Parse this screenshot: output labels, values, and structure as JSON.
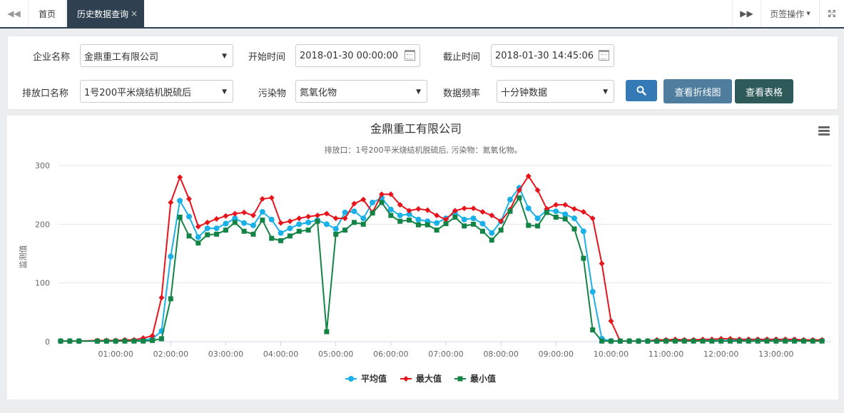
{
  "tabbar": {
    "prev_icon": "double-left-icon",
    "home_label": "首页",
    "active_label": "历史数据查询",
    "close_icon": "×",
    "next_icon": "double-right-icon",
    "tab_ops_label": "页签操作",
    "fullscreen_icon": "expand-icon"
  },
  "filter": {
    "company_label": "企业名称",
    "company_value": "金鼎重工有限公司",
    "start_label": "开始时间",
    "start_value": "2018-01-30 00:00:00",
    "end_label": "截止时间",
    "end_value": "2018-01-30 14:45:06",
    "outlet_label": "排放口名称",
    "outlet_value": "1号200平米烧结机脱硫后",
    "pollutant_label": "污染物",
    "pollutant_value": "氮氧化物",
    "freq_label": "数据频率",
    "freq_value": "十分钟数据",
    "search_icon": "search-icon",
    "line_button": "查看折线图",
    "table_button": "查看表格",
    "colors": {
      "search": "#337ab7",
      "line": "#4f7d9d",
      "table": "#2f5a5a"
    }
  },
  "chart_data": {
    "type": "line",
    "title": "金鼎重工有限公司",
    "subtitle": "排放口：1号200平米烧结机脱硫后, 污染物：氮氧化物。",
    "ylabel": "监测值",
    "ylim": [
      0,
      300
    ],
    "yticks": [
      0,
      100,
      200,
      300
    ],
    "xrange": [
      0,
      840
    ],
    "xticks": [
      {
        "v": 60,
        "label": "01:00:00"
      },
      {
        "v": 120,
        "label": "02:00:00"
      },
      {
        "v": 180,
        "label": "03:00:00"
      },
      {
        "v": 240,
        "label": "04:00:00"
      },
      {
        "v": 300,
        "label": "05:00:00"
      },
      {
        "v": 360,
        "label": "06:00:00"
      },
      {
        "v": 420,
        "label": "07:00:00"
      },
      {
        "v": 480,
        "label": "08:00:00"
      },
      {
        "v": 540,
        "label": "09:00:00"
      },
      {
        "v": 600,
        "label": "10:00:00"
      },
      {
        "v": 660,
        "label": "11:00:00"
      },
      {
        "v": 720,
        "label": "12:00:00"
      },
      {
        "v": 780,
        "label": "13:00:00"
      }
    ],
    "x_minutes": [
      0,
      10,
      20,
      40,
      50,
      60,
      70,
      80,
      90,
      100,
      110,
      120,
      130,
      140,
      150,
      160,
      170,
      180,
      190,
      200,
      210,
      220,
      230,
      240,
      250,
      260,
      270,
      280,
      290,
      300,
      310,
      320,
      330,
      340,
      350,
      360,
      370,
      380,
      390,
      400,
      410,
      420,
      430,
      440,
      450,
      460,
      470,
      480,
      490,
      500,
      510,
      520,
      530,
      540,
      550,
      560,
      570,
      580,
      590,
      600,
      610,
      620,
      630,
      640,
      650,
      660,
      670,
      680,
      690,
      700,
      710,
      720,
      730,
      740,
      750,
      760,
      770,
      780,
      790,
      800,
      810,
      820,
      830
    ],
    "series": [
      {
        "name": "平均值",
        "color": "#1ab0e8",
        "marker": "circle",
        "values": [
          1,
          1,
          1,
          1,
          1,
          1,
          2,
          2,
          3,
          5,
          18,
          145,
          240,
          213,
          178,
          193,
          193,
          201,
          210,
          202,
          198,
          221,
          208,
          185,
          193,
          200,
          203,
          207,
          200,
          192,
          220,
          222,
          210,
          237,
          245,
          225,
          215,
          217,
          208,
          205,
          202,
          210,
          220,
          208,
          210,
          201,
          185,
          205,
          242,
          262,
          227,
          210,
          224,
          222,
          217,
          210,
          188,
          85,
          5,
          1,
          1,
          1,
          1,
          1,
          1,
          2,
          2,
          2,
          2,
          2,
          2,
          2,
          2,
          3,
          3,
          3,
          3,
          3,
          3,
          3,
          2,
          2,
          2
        ]
      },
      {
        "name": "最大值",
        "color": "#e8141c",
        "marker": "diamond",
        "values": [
          1,
          1,
          1,
          2,
          2,
          2,
          3,
          3,
          6,
          10,
          75,
          237,
          280,
          243,
          196,
          203,
          209,
          214,
          218,
          220,
          215,
          243,
          245,
          202,
          205,
          210,
          213,
          215,
          218,
          210,
          210,
          235,
          242,
          220,
          251,
          251,
          233,
          223,
          226,
          224,
          215,
          208,
          223,
          227,
          227,
          221,
          215,
          205,
          225,
          258,
          282,
          258,
          226,
          233,
          233,
          226,
          221,
          210,
          133,
          35,
          1,
          1,
          1,
          1,
          3,
          3,
          4,
          3,
          3,
          4,
          4,
          5,
          5,
          4,
          4,
          4,
          4,
          4,
          4,
          4,
          3,
          3,
          3
        ]
      },
      {
        "name": "最小值",
        "color": "#148446",
        "marker": "square",
        "values": [
          1,
          1,
          1,
          1,
          1,
          1,
          1,
          1,
          1,
          2,
          5,
          73,
          212,
          180,
          168,
          182,
          183,
          190,
          203,
          188,
          183,
          207,
          176,
          172,
          180,
          188,
          190,
          205,
          17,
          183,
          190,
          203,
          200,
          219,
          237,
          215,
          205,
          207,
          199,
          199,
          190,
          201,
          212,
          197,
          200,
          188,
          173,
          190,
          222,
          245,
          198,
          197,
          220,
          212,
          209,
          192,
          142,
          20,
          1,
          1,
          1,
          1,
          1,
          1,
          1,
          1,
          1,
          1,
          1,
          1,
          1,
          1,
          1,
          1,
          1,
          1,
          1,
          1,
          1,
          1,
          1,
          1,
          1
        ]
      }
    ],
    "legend": "bottom-center"
  }
}
